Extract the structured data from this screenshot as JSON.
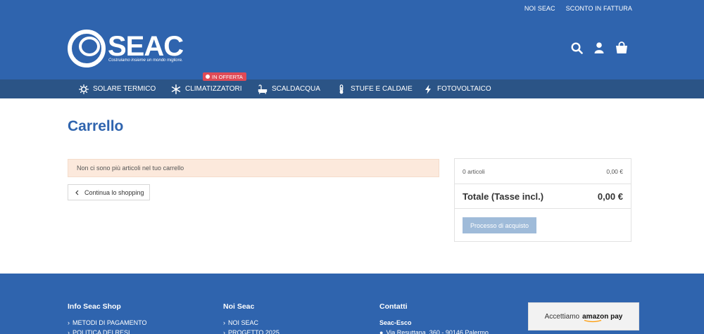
{
  "toplinks": [
    "NOI SEAC",
    "SCONTO IN FATTURA"
  ],
  "logo": {
    "text": "SEAC",
    "tagline": "Costruiamo insieme un mondo migliore."
  },
  "header_icons": [
    "search-icon",
    "user-icon",
    "shopping-bag-icon"
  ],
  "nav": {
    "items": [
      {
        "label": "SOLARE TERMICO",
        "icon": "sun-icon"
      },
      {
        "label": "CLIMATIZZATORI",
        "icon": "snowflake-icon"
      },
      {
        "label": "SCALDACQUA",
        "icon": "bathtub-icon"
      },
      {
        "label": "STUFE E CALDAIE",
        "icon": "thermometer-icon"
      },
      {
        "label": "FOTOVOLTAICO",
        "icon": "bolt-icon"
      }
    ],
    "badge": "IN OFFERTA"
  },
  "page": {
    "title": "Carrello"
  },
  "cart": {
    "notice": "Non ci sono più articoli nel tuo carrello",
    "continue_label": "Continua lo shopping"
  },
  "summary": {
    "items_label": "0 articoli",
    "items_value": "0,00 €",
    "total_label": "Totale (Tasse incl.)",
    "total_value": "0,00 €",
    "checkout_label": "Processo di acquisto"
  },
  "footer": {
    "col1": {
      "title": "Info Seac Shop",
      "links": [
        "METODI DI PAGAMENTO",
        "POLITICA DEI RESI"
      ]
    },
    "col2": {
      "title": "Noi Seac",
      "links": [
        "NOI SEAC",
        "PROGETTO 2025"
      ]
    },
    "col3": {
      "title": "Contatti",
      "company": "Seac-Esco",
      "address": "Via Resuttana, 360 - 90146 Palermo"
    },
    "amazon": {
      "prefix": "Accettiamo",
      "brand": "amazon pay"
    }
  },
  "colors": {
    "brand_blue": "#2f64ae",
    "nav_blue": "#2b5486",
    "badge_red": "#e04a56",
    "notice_bg": "#fce9dc",
    "checkout_disabled": "#9fbbd9"
  }
}
